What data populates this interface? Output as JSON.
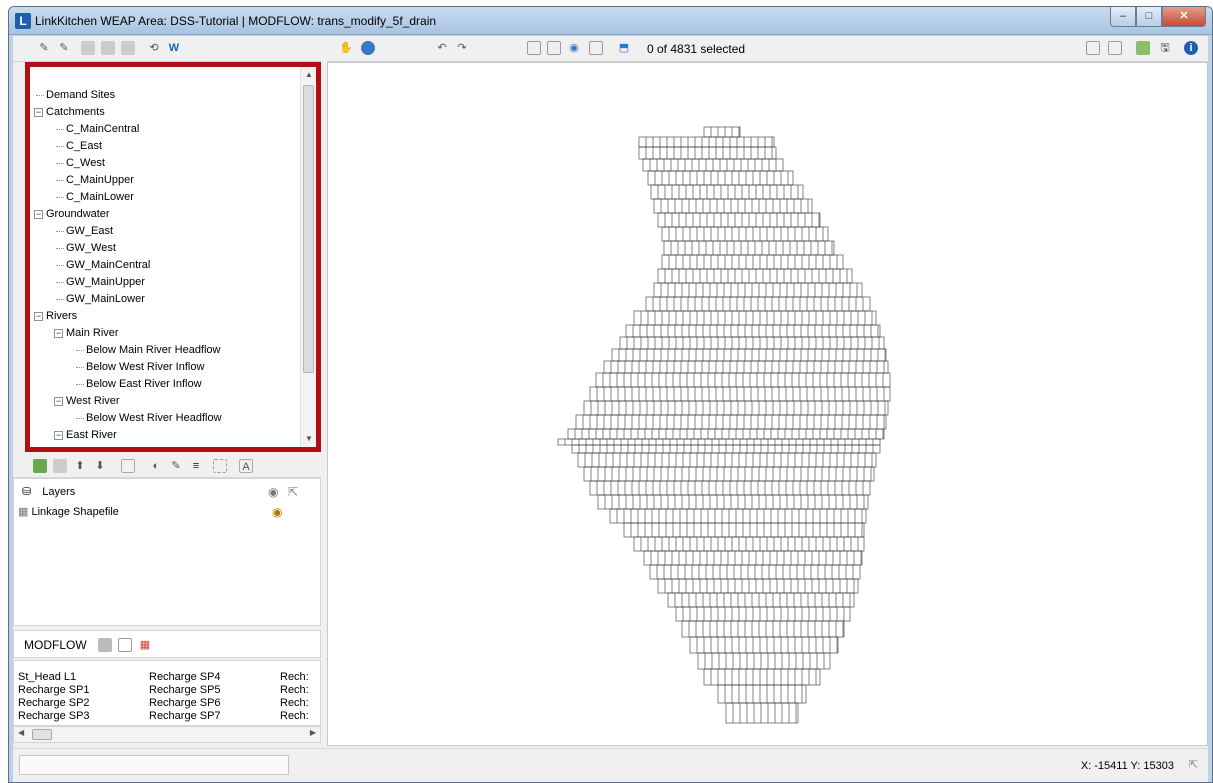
{
  "window": {
    "title": "LinkKitchen   WEAP Area: DSS-Tutorial | MODFLOW: trans_modify_5f_drain",
    "icon": "L",
    "buttons": {
      "minimize": "–",
      "maximize": "□",
      "close": "✕"
    }
  },
  "tree": {
    "items": [
      {
        "label": "Demand Sites",
        "level": 0
      },
      {
        "label": "Catchments",
        "level": 0,
        "expanded": true
      },
      {
        "label": "C_MainCentral",
        "level": 1
      },
      {
        "label": "C_East",
        "level": 1
      },
      {
        "label": "C_West",
        "level": 1
      },
      {
        "label": "C_MainUpper",
        "level": 1
      },
      {
        "label": "C_MainLower",
        "level": 1
      },
      {
        "label": "Groundwater",
        "level": 0,
        "expanded": true
      },
      {
        "label": "GW_East",
        "level": 1
      },
      {
        "label": "GW_West",
        "level": 1
      },
      {
        "label": "GW_MainCentral",
        "level": 1
      },
      {
        "label": "GW_MainUpper",
        "level": 1
      },
      {
        "label": "GW_MainLower",
        "level": 1
      },
      {
        "label": "Rivers",
        "level": 0,
        "expanded": true
      },
      {
        "label": "Main River",
        "level": 1,
        "expanded": true
      },
      {
        "label": "Below Main River Headflow",
        "level": 2
      },
      {
        "label": "Below West River Inflow",
        "level": 2
      },
      {
        "label": "Below East River Inflow",
        "level": 2
      },
      {
        "label": "West River",
        "level": 1,
        "expanded": true
      },
      {
        "label": "Below West River Headflow",
        "level": 2
      },
      {
        "label": "East River",
        "level": 1,
        "expanded": true
      }
    ]
  },
  "layers": {
    "header": "Layers",
    "items": [
      {
        "label": "Linkage Shapefile",
        "visible": true
      }
    ]
  },
  "modflow": {
    "label": "MODFLOW",
    "columns": [
      [
        "St_Head L1",
        "Recharge SP1",
        "Recharge SP2",
        "Recharge SP3"
      ],
      [
        "Recharge SP4",
        "Recharge SP5",
        "Recharge SP6",
        "Recharge SP7"
      ],
      [
        "Rech:",
        "Rech:",
        "Rech:",
        "Rech:"
      ]
    ]
  },
  "map": {
    "selection_text": "0 of 4831 selected"
  },
  "status": {
    "coords": "X: -15411  Y: 15303"
  },
  "colors": {
    "highlight_border": "#b00f14",
    "grid_line": "#333333"
  }
}
